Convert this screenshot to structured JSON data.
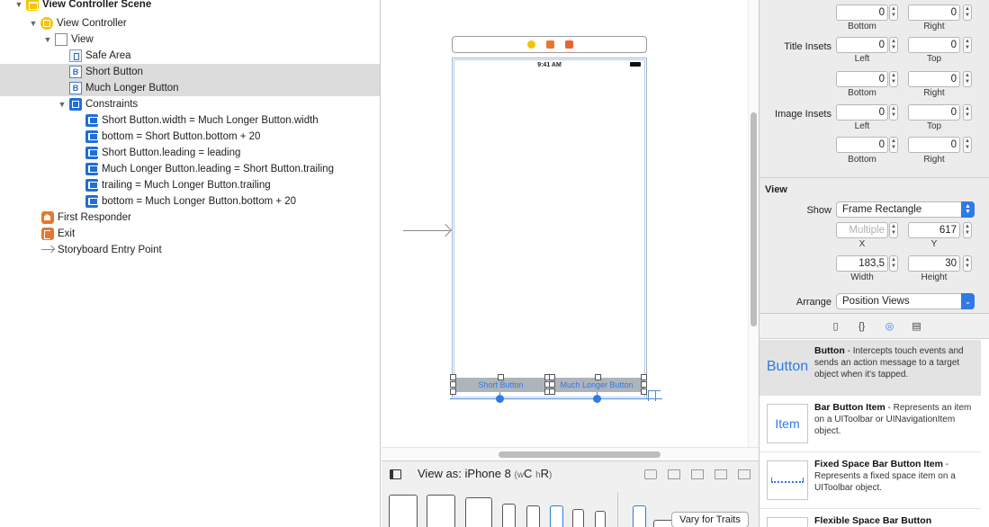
{
  "outline": {
    "items": [
      {
        "label": "View Controller Scene",
        "depth": 0,
        "icon": "scene-icon"
      },
      {
        "label": "View Controller",
        "depth": 1,
        "icon": "view-controller-icon"
      },
      {
        "label": "View",
        "depth": 2,
        "icon": "view-icon"
      },
      {
        "label": "Safe Area",
        "depth": 3,
        "icon": "safe-area-icon"
      },
      {
        "label": "Short Button",
        "depth": 3,
        "icon": "button-icon"
      },
      {
        "label": "Much Longer Button",
        "depth": 3,
        "icon": "button-icon"
      },
      {
        "label": "Constraints",
        "depth": 3,
        "icon": "constraints-icon"
      },
      {
        "label": "Short Button.width = Much Longer Button.width",
        "depth": 4,
        "icon": "constraint-icon"
      },
      {
        "label": "bottom = Short Button.bottom + 20",
        "depth": 4,
        "icon": "constraint-icon"
      },
      {
        "label": "Short Button.leading = leading",
        "depth": 4,
        "icon": "constraint-icon"
      },
      {
        "label": "Much Longer Button.leading = Short Button.trailing",
        "depth": 4,
        "icon": "constraint-icon"
      },
      {
        "label": "trailing = Much Longer Button.trailing",
        "depth": 4,
        "icon": "constraint-icon"
      },
      {
        "label": "bottom = Much Longer Button.bottom + 20",
        "depth": 4,
        "icon": "constraint-icon"
      },
      {
        "label": "First Responder",
        "depth": 1,
        "icon": "first-responder-icon"
      },
      {
        "label": "Exit",
        "depth": 1,
        "icon": "exit-icon"
      },
      {
        "label": "Storyboard Entry Point",
        "depth": 1,
        "icon": "entry-point-icon"
      }
    ]
  },
  "canvas": {
    "status_time": "9:41 AM",
    "short_button": "Short Button",
    "long_button": "Much Longer Button",
    "colors": {
      "tint": "#2f7ae5",
      "selection": "#dcdcdc"
    }
  },
  "bottombar": {
    "view_as": "View as: iPhone 8",
    "traits_w": "w",
    "traits_wc": "C",
    "traits_h": "h",
    "traits_hr": "R",
    "vary_button": "Vary for Traits"
  },
  "inspector": {
    "rows": {
      "r0": {
        "a": "0",
        "b": "0",
        "la": "Bottom",
        "lb": "Right"
      },
      "title_insets": {
        "label": "Title Insets",
        "a": "0",
        "b": "0",
        "la": "Left",
        "lb": "Top"
      },
      "r2": {
        "a": "0",
        "b": "0",
        "la": "Bottom",
        "lb": "Right"
      },
      "image_insets": {
        "label": "Image Insets",
        "a": "0",
        "b": "0",
        "la": "Left",
        "lb": "Top"
      },
      "r4": {
        "a": "0",
        "b": "0",
        "la": "Bottom",
        "lb": "Right"
      }
    },
    "view_section": "View",
    "show_label": "Show",
    "show_value": "Frame Rectangle",
    "x_value": "Multiple",
    "y_value": "617",
    "x_label": "X",
    "y_label": "Y",
    "width_value": "183,5",
    "height_value": "30",
    "width_label": "Width",
    "height_label": "Height",
    "arrange_label": "Arrange",
    "arrange_value": "Position Views"
  },
  "library": {
    "items": [
      {
        "icon_text": "Button",
        "title": "Button",
        "desc": " - Intercepts touch events and sends an action message to a target object when it's tapped."
      },
      {
        "icon_text": "Item",
        "title": "Bar Button Item",
        "desc": " - Represents an item on a UIToolbar or UINavigationItem object."
      },
      {
        "icon_text": "",
        "title": "Fixed Space Bar Button Item",
        "desc": " - Represents a fixed space item on a UIToolbar object."
      },
      {
        "icon_text": "",
        "title": "Flexible Space Bar Button",
        "desc": ""
      }
    ]
  }
}
